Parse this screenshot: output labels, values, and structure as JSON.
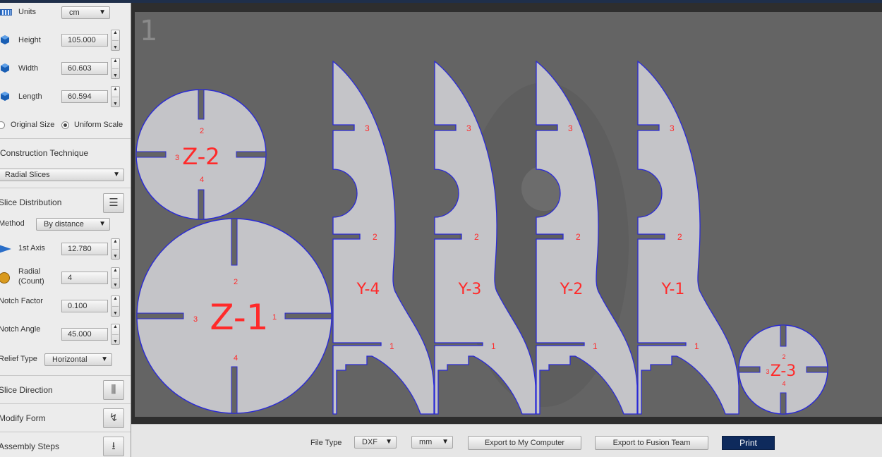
{
  "panel": {
    "units_label": "Units",
    "units_value": "cm",
    "height_label": "Height",
    "height_value": "105.000",
    "width_label": "Width",
    "width_value": "60.603",
    "length_label": "Length",
    "length_value": "60.594",
    "original_size_label": "Original Size",
    "uniform_scale_label": "Uniform Scale",
    "construction_title": "Construction Technique",
    "construction_value": "Radial Slices",
    "slice_distribution_title": "Slice Distribution",
    "method_label": "Method",
    "method_value": "By distance",
    "first_axis_label": "1st Axis",
    "first_axis_value": "12.780",
    "radial_label": "Radial",
    "radial_count_label": "(Count)",
    "radial_value": "4",
    "notch_factor_label": "Notch Factor",
    "notch_factor_value": "0.100",
    "notch_angle_label": "Notch Angle",
    "notch_angle_value": "45.000",
    "relief_type_label": "Relief Type",
    "relief_type_value": "Horizontal",
    "slice_direction_title": "Slice Direction",
    "modify_form_title": "Modify Form",
    "assembly_steps_title": "Assembly Steps"
  },
  "canvas": {
    "page_number": "1",
    "parts": {
      "z2": {
        "label": "Z-2",
        "notch_top": "2",
        "notch_left": "3",
        "notch_bottom": "4"
      },
      "z1": {
        "label": "Z-1",
        "notch_top": "2",
        "notch_left": "3",
        "notch_right": "1",
        "notch_bottom": "4"
      },
      "z3": {
        "label": "Z-3",
        "notch_top": "2",
        "notch_left": "3",
        "notch_bottom": "4"
      },
      "ribs": [
        {
          "label": "Y-4",
          "n3": "3",
          "n2": "2",
          "n1": "1"
        },
        {
          "label": "Y-3",
          "n3": "3",
          "n2": "2",
          "n1": "1"
        },
        {
          "label": "Y-2",
          "n3": "3",
          "n2": "2",
          "n1": "1"
        },
        {
          "label": "Y-1",
          "n3": "3",
          "n2": "2",
          "n1": "1"
        }
      ]
    },
    "colors": {
      "part_fill": "#c4c4c8",
      "part_stroke": "#2a2ad6",
      "label": "#ff2a2a",
      "sheet": "#646464"
    }
  },
  "bottom": {
    "file_type_label": "File Type",
    "file_type_value": "DXF",
    "unit_value": "mm",
    "export_computer": "Export to My Computer",
    "export_fusion": "Export to Fusion Team",
    "print": "Print"
  }
}
